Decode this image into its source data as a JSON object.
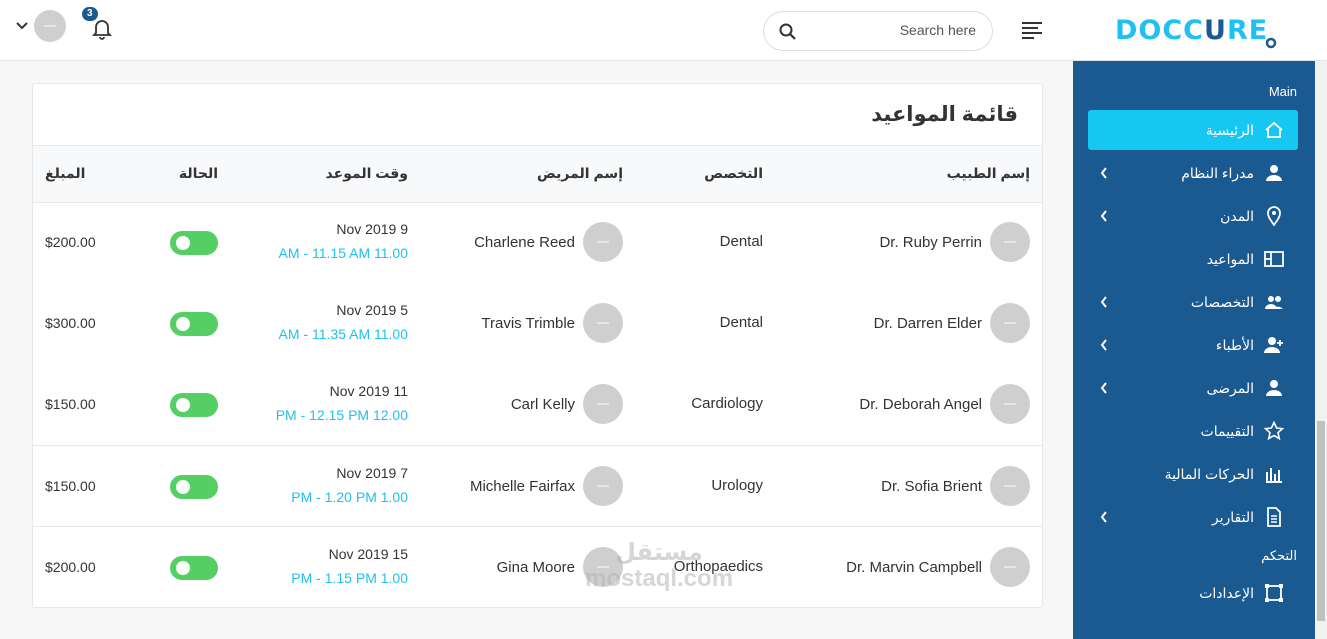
{
  "header": {
    "notif_count": "3",
    "search_placeholder": "Search here",
    "logo_main": "DOCC",
    "logo_tail": "RE"
  },
  "sidebar": {
    "section_main": "Main",
    "section_control": "التحكم",
    "items": [
      {
        "label": "الرئيسية",
        "icon": "home-icon",
        "active": true
      },
      {
        "label": "مدراء النظام",
        "icon": "user-icon"
      },
      {
        "label": "المدن",
        "icon": "map-pin-icon"
      },
      {
        "label": "المواعيد",
        "icon": "layout-icon"
      },
      {
        "label": "التخصصات",
        "icon": "people-icon"
      },
      {
        "label": "الأطباء",
        "icon": "user-plus-icon"
      },
      {
        "label": "المرضى",
        "icon": "user-icon"
      },
      {
        "label": "التقييمات",
        "icon": "star-icon"
      },
      {
        "label": "الحركات المالية",
        "icon": "bar-chart-icon"
      },
      {
        "label": "التقارير",
        "icon": "file-icon"
      },
      {
        "label": "الإعدادات",
        "icon": "settings-frame-icon"
      }
    ]
  },
  "card": {
    "title": "قائمة المواعيد",
    "columns": {
      "doctor": "إسم الطبيب",
      "specialty": "التخصص",
      "patient": "إسم المريض",
      "time": "وقت الموعد",
      "status": "الحالة",
      "amount": "المبلغ"
    },
    "rows": [
      {
        "doctor": "Dr. Ruby Perrin",
        "specialty": "Dental",
        "patient": "Charlene Reed",
        "date": "Nov 2019 9",
        "time": "AM - 11.15 AM 11.00",
        "amount": "$200.00"
      },
      {
        "doctor": "Dr. Darren Elder",
        "specialty": "Dental",
        "patient": "Travis Trimble",
        "date": "Nov 2019 5",
        "time": "AM - 11.35 AM 11.00",
        "amount": "$300.00"
      },
      {
        "doctor": "Dr. Deborah Angel",
        "specialty": "Cardiology",
        "patient": "Carl Kelly",
        "date": "Nov 2019 11",
        "time": "PM - 12.15 PM 12.00",
        "amount": "$150.00"
      },
      {
        "doctor": "Dr. Sofia Brient",
        "specialty": "Urology",
        "patient": "Michelle Fairfax",
        "date": "Nov 2019 7",
        "time": "PM - 1.20 PM 1.00",
        "amount": "$150.00"
      },
      {
        "doctor": "Dr. Marvin Campbell",
        "specialty": "Orthopaedics",
        "patient": "Gina Moore",
        "date": "Nov 2019 15",
        "time": "PM - 1.15 PM 1.00",
        "amount": "$200.00"
      }
    ]
  },
  "watermark": {
    "line1": "مستقل",
    "line2": "mostaql.com"
  },
  "colors": {
    "sidebar": "#1b5a90",
    "accent": "#20c0f3",
    "toggle_on": "#55ce63"
  }
}
